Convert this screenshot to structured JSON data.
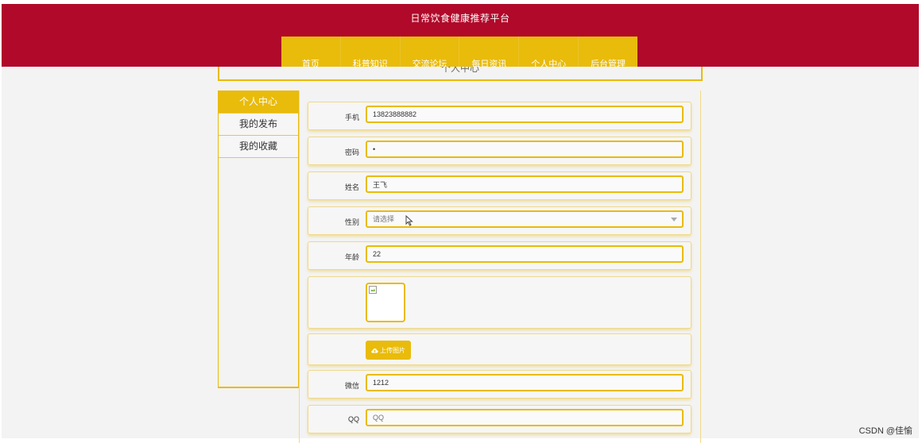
{
  "header": {
    "site_title": "日常饮食健康推荐平台",
    "nav": [
      "首页",
      "科普知识",
      "交流论坛",
      "每日资讯",
      "个人中心",
      "后台管理"
    ]
  },
  "page": {
    "section_title": "个人中心"
  },
  "sidebar": {
    "items": [
      {
        "label": "个人中心",
        "active": true
      },
      {
        "label": "我的发布",
        "active": false
      },
      {
        "label": "我的收藏",
        "active": false
      }
    ]
  },
  "form": {
    "phone": {
      "label": "手机",
      "value": "13823888882"
    },
    "password": {
      "label": "密码",
      "value": "•"
    },
    "name": {
      "label": "姓名",
      "value": "王飞"
    },
    "gender": {
      "label": "性别",
      "placeholder": "请选择"
    },
    "age": {
      "label": "年龄",
      "value": "22"
    },
    "upload_label": "上传图片",
    "wechat": {
      "label": "微信",
      "value": "1212"
    },
    "qq": {
      "label": "QQ",
      "placeholder": "QQ"
    }
  },
  "watermark": "CSDN @佳愉",
  "colors": {
    "header_red": "#b0092a",
    "accent_gold": "#e9bb0b"
  },
  "icons": {
    "upload": "cloud-upload-icon",
    "select": "chevron-down-icon",
    "pointer": "mouse-pointer-icon",
    "image": "broken-image-icon"
  }
}
